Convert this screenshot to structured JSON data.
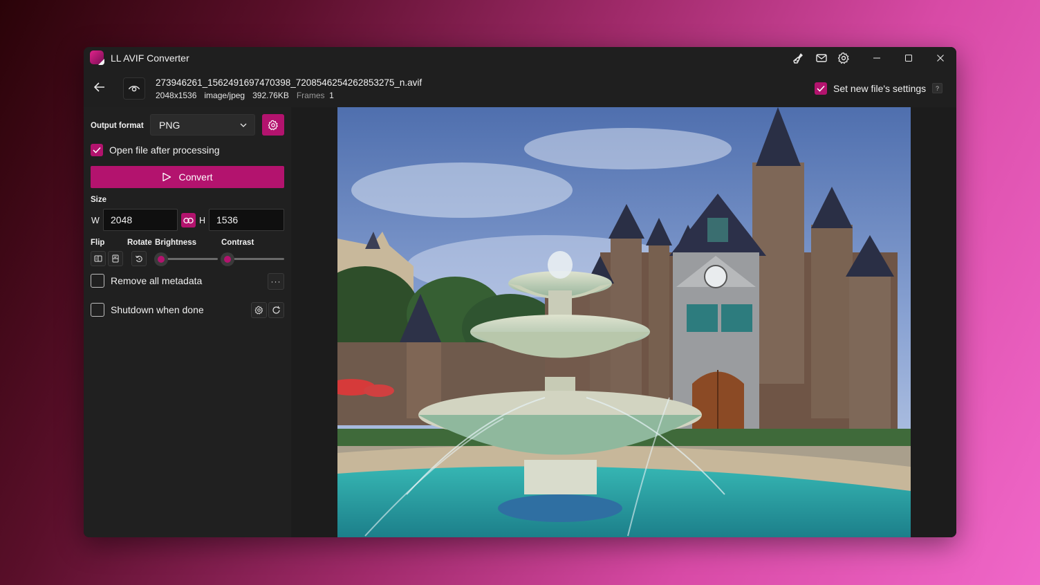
{
  "app": {
    "title": "LL AVIF Converter"
  },
  "header": {
    "file_name": "273946261_1562491697470398_7208546254262853275_n.avif",
    "dimensions": "2048x1536",
    "mime": "image/jpeg",
    "file_size": "392.76KB",
    "frames_label": "Frames",
    "frames_value": "1",
    "new_settings_label": "Set new file's settings",
    "new_settings_checked": true,
    "help_label": "?"
  },
  "sidebar": {
    "output_format_label": "Output format",
    "output_format_value": "PNG",
    "open_after_label": "Open file after processing",
    "open_after_checked": true,
    "convert_label": "Convert",
    "size_label": "Size",
    "width_label": "W",
    "width_value": "2048",
    "height_label": "H",
    "height_value": "1536",
    "flip_label": "Flip",
    "rotate_label": "Rotate",
    "brightness_label": "Brightness",
    "brightness_level": 0,
    "contrast_label": "Contrast",
    "contrast_level": 0,
    "remove_metadata_label": "Remove all metadata",
    "remove_metadata_checked": false,
    "more_label": "···",
    "shutdown_label": "Shutdown when done",
    "shutdown_checked": false
  },
  "colors": {
    "accent": "#b3136e",
    "window": "#1f1f1f",
    "sidebar": "#202020"
  },
  "icons": {
    "titlebar": [
      "broom-icon",
      "mail-icon",
      "gear-icon",
      "minimize-icon",
      "maximize-icon",
      "close-icon"
    ],
    "header": [
      "back-arrow-icon",
      "eye-icon"
    ]
  }
}
